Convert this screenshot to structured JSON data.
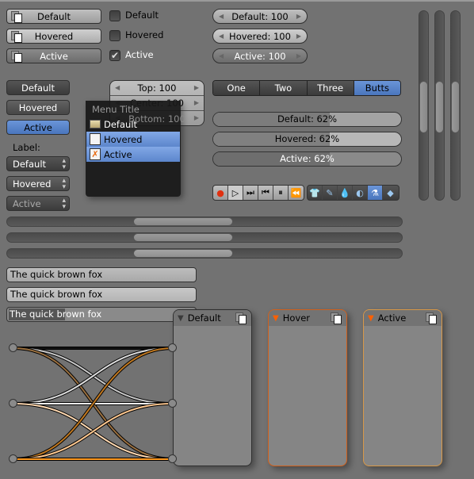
{
  "icon_buttons": [
    {
      "label": "Default",
      "state": "default"
    },
    {
      "label": "Hovered",
      "state": "hovered"
    },
    {
      "label": "Active",
      "state": "active"
    }
  ],
  "checkboxes": [
    {
      "label": "Default",
      "checked": false
    },
    {
      "label": "Hovered",
      "checked": false
    },
    {
      "label": "Active",
      "checked": true
    }
  ],
  "number_fields": [
    {
      "label": "Default: 100"
    },
    {
      "label": "Hovered: 100"
    },
    {
      "label": "Active: 100"
    }
  ],
  "buttons": [
    {
      "label": "Default"
    },
    {
      "label": "Hovered"
    },
    {
      "label": "Active"
    }
  ],
  "column_numbers": [
    {
      "label": "Top: 100"
    },
    {
      "label": "Center: 100"
    },
    {
      "label": "Bottom: 100"
    }
  ],
  "label": "Label:",
  "menus": [
    {
      "label": "Default"
    },
    {
      "label": "Hovered"
    },
    {
      "label": "Active"
    }
  ],
  "popup_menu": {
    "title": "Menu Title",
    "items": [
      {
        "label": "Default",
        "icon": "folder-icon"
      },
      {
        "label": "Hovered",
        "icon": "file-icon"
      },
      {
        "label": "Active",
        "icon": "blender-file-icon"
      }
    ]
  },
  "tabs": [
    {
      "label": "One"
    },
    {
      "label": "Two"
    },
    {
      "label": "Three"
    },
    {
      "label": "Butts",
      "active": true
    }
  ],
  "progress_bars": [
    {
      "label": "Default: 62%",
      "value": 62
    },
    {
      "label": "Hovered: 62%",
      "value": 62
    },
    {
      "label": "Active: 62%",
      "value": 62
    }
  ],
  "playback_icons": [
    "record-icon",
    "play-icon",
    "skip-forward-icon",
    "skip-back-icon",
    "pause-icon",
    "rewind-icon"
  ],
  "property_icons": [
    "shirt-icon",
    "paint-icon",
    "drop-icon",
    "light-icon",
    "physics-icon",
    "cube-icon"
  ],
  "text_fields": [
    {
      "value": "The quick brown fox"
    },
    {
      "value": "The quick brown fox"
    },
    {
      "value": "The quick brown fox",
      "selected": "The quick br"
    }
  ],
  "panels": [
    {
      "title": "Default",
      "border": "#2e2e2e",
      "arrow": "#3a3a3a"
    },
    {
      "title": "Hover",
      "border": "#d0601c",
      "arrow": "#ff6000"
    },
    {
      "title": "Active",
      "border": "#d89848",
      "arrow": "#ff6000"
    }
  ],
  "colors": {
    "background": "#727272",
    "accent": "#5680c2",
    "orange": "#ff8c1a"
  }
}
